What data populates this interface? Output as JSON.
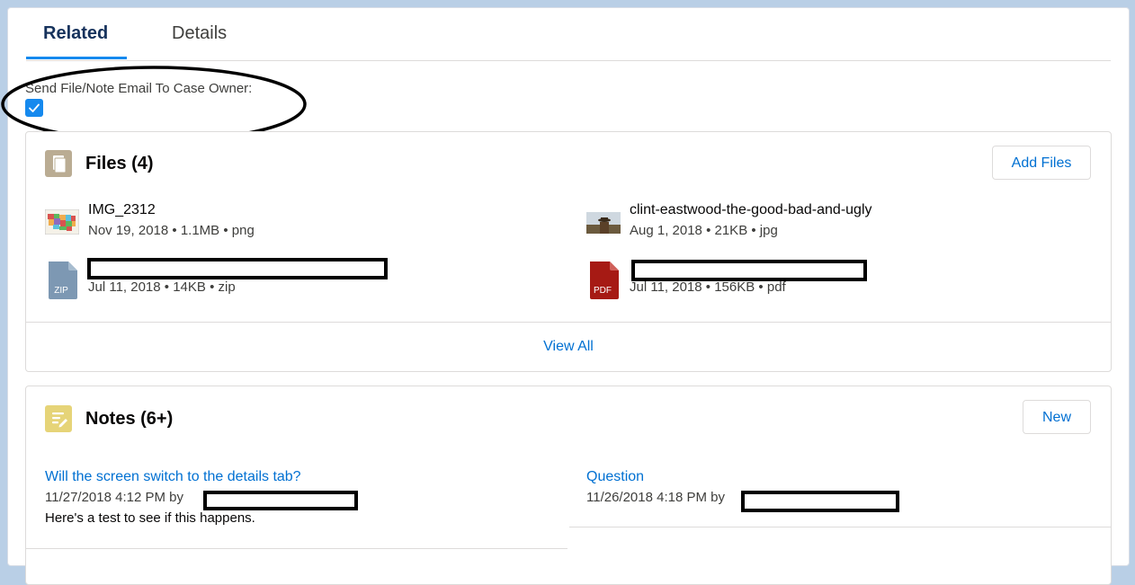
{
  "tabs": [
    {
      "label": "Related",
      "active": true
    },
    {
      "label": "Details",
      "active": false
    }
  ],
  "send_email": {
    "label": "Send File/Note Email To Case Owner:",
    "checked": true
  },
  "files": {
    "title": "Files (4)",
    "add_button": "Add Files",
    "view_all": "View All",
    "items": [
      {
        "name": "IMG_2312",
        "date": "Nov 19, 2018",
        "size": "1.1MB",
        "ext": "png",
        "icon": "map-thumbnail"
      },
      {
        "name": "clint-eastwood-the-good-bad-and-ugly",
        "date": "Aug 1, 2018",
        "size": "21KB",
        "ext": "jpg",
        "icon": "photo-thumbnail"
      },
      {
        "name": "",
        "date": "Jul 11, 2018",
        "size": "14KB",
        "ext": "zip",
        "icon": "zip-file-icon",
        "icon_label": "ZIP"
      },
      {
        "name": "",
        "date": "Jul 11, 2018",
        "size": "156KB",
        "ext": "pdf",
        "icon": "pdf-file-icon",
        "icon_label": "PDF"
      }
    ]
  },
  "notes": {
    "title": "Notes (6+)",
    "new_button": "New",
    "items": [
      {
        "title": "Will the screen switch to the details tab?",
        "timestamp": "11/27/2018 4:12 PM",
        "by": "by",
        "body": "Here's a test to see if this happens."
      },
      {
        "title": "Question",
        "timestamp": "11/26/2018 4:18 PM",
        "by": "by",
        "body": ""
      }
    ]
  },
  "colors": {
    "brand": "#1589ee",
    "link": "#0070d2",
    "files_icon": "#baac93",
    "notes_icon": "#e6d478",
    "zip_icon": "#7d98b3",
    "pdf_icon": "#a61a14"
  }
}
